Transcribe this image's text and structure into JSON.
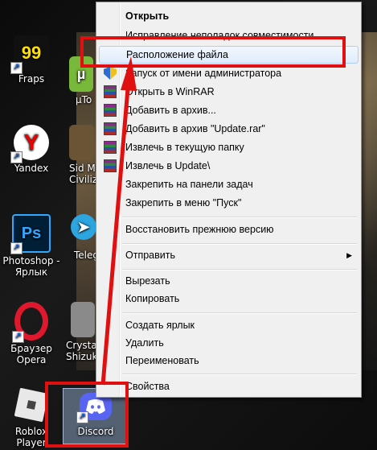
{
  "desktop_icons": [
    {
      "label": "Fraps",
      "badge": "99"
    },
    {
      "label": "µTo"
    },
    {
      "label": "Yandex"
    },
    {
      "label": "Sid M Civiliz"
    },
    {
      "label": "Photoshop - Ярлык",
      "icon_text": "Ps"
    },
    {
      "label": "Teleg"
    },
    {
      "label": "Браузер Opera"
    },
    {
      "label": "Crysta Shizuk"
    },
    {
      "label": "Roblox Player"
    },
    {
      "label": "Discord"
    }
  ],
  "context_menu": {
    "items": [
      {
        "label": "Открыть",
        "bold": true
      },
      {
        "label": "Исправление неполадок совместимости"
      },
      {
        "label": "Расположение файла",
        "highlighted": true
      },
      {
        "label": "Запуск от имени администратора",
        "icon": "shield-icon"
      },
      {
        "label": "Открыть в WinRAR",
        "icon": "winrar-icon"
      },
      {
        "label": "Добавить в архив...",
        "icon": "winrar-icon"
      },
      {
        "label": "Добавить в архив \"Update.rar\"",
        "icon": "winrar-icon"
      },
      {
        "label": "Извлечь в текущую папку",
        "icon": "winrar-icon"
      },
      {
        "label": "Извлечь в Update\\",
        "icon": "winrar-icon"
      },
      {
        "label": "Закрепить на панели задач"
      },
      {
        "label": "Закрепить в меню \"Пуск\""
      },
      {
        "label": "Восстановить прежнюю версию"
      },
      {
        "label": "Отправить",
        "has_submenu": true
      },
      {
        "label": "Вырезать"
      },
      {
        "label": "Копировать"
      },
      {
        "label": "Создать ярлык"
      },
      {
        "label": "Удалить"
      },
      {
        "label": "Переименовать"
      },
      {
        "label": "Свойства"
      }
    ]
  },
  "colors": {
    "highlight_box": "#e01010",
    "menu_background": "#f0f0f0",
    "discord_blue": "#5865f2"
  }
}
